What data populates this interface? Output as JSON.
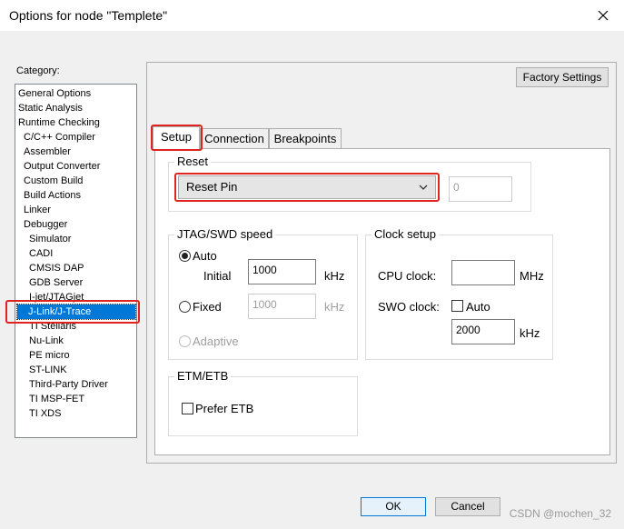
{
  "window": {
    "title": "Options for node \"Templete\"",
    "close_symbol": "✕"
  },
  "category": {
    "label": "Category:",
    "items": [
      "General Options",
      "Static Analysis",
      "Runtime Checking",
      "C/C++ Compiler",
      "Assembler",
      "Output Converter",
      "Custom Build",
      "Build Actions",
      "Linker",
      "Debugger",
      "Simulator",
      "CADI",
      "CMSIS DAP",
      "GDB Server",
      "I-jet/JTAGjet",
      "J-Link/J-Trace",
      "TI Stellaris",
      "Nu-Link",
      "PE micro",
      "ST-LINK",
      "Third-Party Driver",
      "TI MSP-FET",
      "TI XDS"
    ],
    "selected": "J-Link/J-Trace"
  },
  "factory_settings_label": "Factory Settings",
  "tabs": [
    "Setup",
    "Connection",
    "Breakpoints"
  ],
  "active_tab": "Setup",
  "reset": {
    "group_label": "Reset",
    "selected": "Reset Pin",
    "value": "0"
  },
  "jtag": {
    "group_label": "JTAG/SWD speed",
    "auto_label": "Auto",
    "initial_label": "Initial",
    "initial_value": "1000",
    "initial_unit": "kHz",
    "fixed_label": "Fixed",
    "fixed_value": "1000",
    "fixed_unit": "kHz",
    "adaptive_label": "Adaptive",
    "selected": "Auto"
  },
  "clock": {
    "group_label": "Clock setup",
    "cpu_label": "CPU clock:",
    "cpu_value": "",
    "cpu_unit": "MHz",
    "swo_label": "SWO clock:",
    "swo_auto_label": "Auto",
    "swo_auto_checked": false,
    "swo_value": "2000",
    "swo_unit": "kHz"
  },
  "etm": {
    "group_label": "ETM/ETB",
    "prefer_label": "Prefer ETB",
    "prefer_checked": false
  },
  "buttons": {
    "ok": "OK",
    "cancel": "Cancel"
  },
  "watermark": "CSDN @mochen_32",
  "colors": {
    "highlight": "#e0231e",
    "selection": "#0078d7"
  }
}
